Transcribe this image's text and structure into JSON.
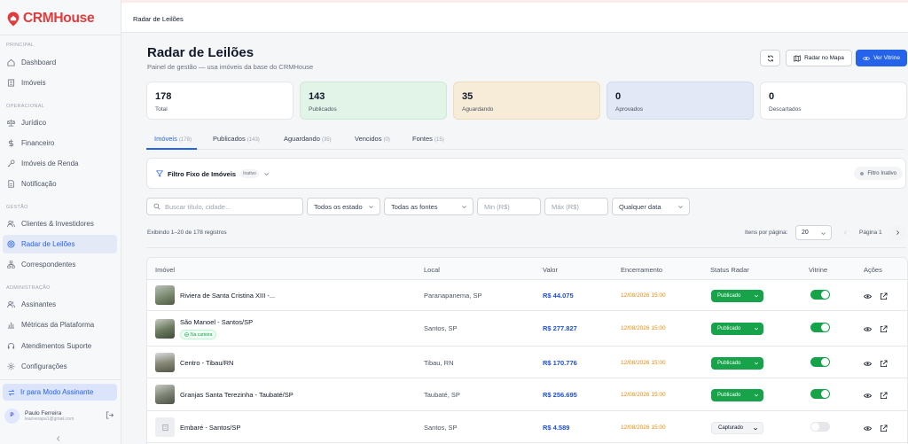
{
  "app": {
    "name": "CRMHouse",
    "brand_color": "#e23b3b",
    "accent_color": "#2563eb"
  },
  "sidebar": {
    "sections": [
      {
        "title": "PRINCIPAL",
        "items": [
          {
            "label": "Dashboard",
            "icon": "home-icon"
          },
          {
            "label": "Imóveis",
            "icon": "building-icon"
          }
        ]
      },
      {
        "title": "OPERACIONAL",
        "items": [
          {
            "label": "Jurídico",
            "icon": "scale-icon"
          },
          {
            "label": "Financeiro",
            "icon": "dollar-icon"
          },
          {
            "label": "Imóveis de Renda",
            "icon": "key-icon"
          },
          {
            "label": "Notificação",
            "icon": "document-icon"
          }
        ]
      },
      {
        "title": "GESTÃO",
        "items": [
          {
            "label": "Clientes & Investidores",
            "icon": "users-icon"
          },
          {
            "label": "Radar de Leilões",
            "icon": "radar-icon",
            "active": true
          },
          {
            "label": "Correspondentes",
            "icon": "network-icon"
          }
        ]
      },
      {
        "title": "ADMINISTRAÇÃO",
        "items": [
          {
            "label": "Assinantes",
            "icon": "users-icon"
          },
          {
            "label": "Métricas da Plataforma",
            "icon": "chart-icon"
          },
          {
            "label": "Atendimentos Suporte",
            "icon": "headset-icon"
          },
          {
            "label": "Configurações",
            "icon": "gear-icon"
          }
        ]
      }
    ],
    "assinante_mode": "Ir para Modo Assinante",
    "user": {
      "initial": "P",
      "name": "Paulo Ferreira",
      "email": "leaoverapa1@gmail.com"
    }
  },
  "header": {
    "title": "Radar de Leilões"
  },
  "page": {
    "title": "Radar de Leilões",
    "subtitle": "Painel de gestão — usa imóveis da base do CRMHouse",
    "buttons": {
      "map": "Radar no Mapa",
      "vitrine": "Ver Vitrine"
    }
  },
  "stats": [
    {
      "value": "178",
      "label": "Total",
      "bg": "#ffffff"
    },
    {
      "value": "143",
      "label": "Publicados",
      "bg": "#e2f3e8"
    },
    {
      "value": "35",
      "label": "Aguardando",
      "bg": "#f7ecd8"
    },
    {
      "value": "0",
      "label": "Aprovados",
      "bg": "#e2e8f5"
    },
    {
      "value": "0",
      "label": "Descartados",
      "bg": "#ffffff"
    }
  ],
  "tabs": [
    {
      "label": "Imóveis",
      "count": "(178)",
      "active": true
    },
    {
      "label": "Publicados",
      "count": "(143)"
    },
    {
      "label": "Aguardando",
      "count": "(35)"
    },
    {
      "label": "Vencidos",
      "count": "(0)"
    },
    {
      "label": "Fontes",
      "count": "(15)"
    }
  ],
  "filter": {
    "title": "Filtro Fixo de Imóveis",
    "pill": "Inativo",
    "status": "Filtro Inativo"
  },
  "search": {
    "placeholder": "Buscar título, cidade...",
    "estado": "Todos os estado",
    "fontes": "Todas as fontes",
    "min_placeholder": "Min (R$)",
    "max_placeholder": "Máx (R$)",
    "data": "Qualquer data"
  },
  "pagination": {
    "showing": "Exibindo 1–20 de 178 registros",
    "per_page_label": "Itens por página:",
    "per_page": "20",
    "page": "Página 1"
  },
  "table": {
    "headers": [
      "Imóvel",
      "Local",
      "Valor",
      "Encerramento",
      "Status Radar",
      "Vitrine",
      "Ações"
    ],
    "rows": [
      {
        "title": "Riviera de Santa Cristina XIII -...",
        "local": "Paranapanema, SP",
        "valor": "R$ 44.075",
        "encerramento": "12/08/2026 15:00",
        "status": "Publicado",
        "vitrine": true,
        "thumb": "#7a8a6d"
      },
      {
        "title": "São Manoel - Santos/SP",
        "badge": "Na carteira",
        "local": "Santos, SP",
        "valor": "R$ 277.827",
        "encerramento": "12/08/2026 15:00",
        "status": "Publicado",
        "vitrine": true,
        "thumb": "#6f7d63"
      },
      {
        "title": "Centro - Tibau/RN",
        "local": "Tibau, RN",
        "valor": "R$ 170.776",
        "encerramento": "12/08/2026 15:00",
        "status": "Publicado",
        "vitrine": true,
        "thumb": "#8b8a7a"
      },
      {
        "title": "Granjas Santa Terezinha - Taubaté/SP",
        "local": "Taubaté, SP",
        "valor": "R$ 256.695",
        "encerramento": "12/08/2026 15:00",
        "status": "Publicado",
        "vitrine": true,
        "thumb": "#7e8576"
      },
      {
        "title": "Embaré - Santos/SP",
        "local": "Santos, SP",
        "valor": "R$ 4.589",
        "encerramento": "12/08/2026 15:00",
        "status": "Capturado",
        "vitrine": false,
        "thumb": "#eceef1"
      }
    ]
  }
}
